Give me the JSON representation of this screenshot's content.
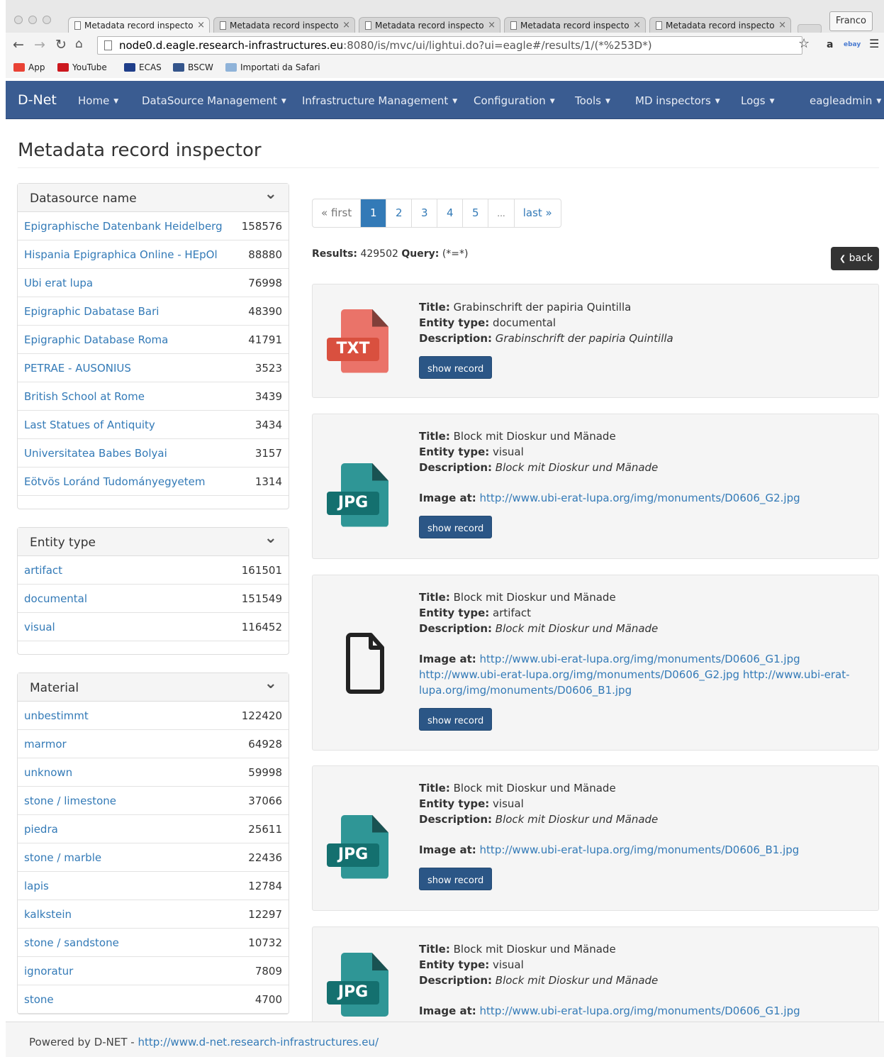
{
  "browser": {
    "tabs": [
      {
        "title": "Metadata record inspecto",
        "active": true
      },
      {
        "title": "Metadata record inspecto",
        "active": false
      },
      {
        "title": "Metadata record inspecto",
        "active": false
      },
      {
        "title": "Metadata record inspecto",
        "active": false
      },
      {
        "title": "Metadata record inspecto",
        "active": false
      }
    ],
    "profile": "Franco",
    "url_host": "node0.d.eagle.research-infrastructures.eu",
    "url_rest": ":8080/is/mvc/ui/lightui.do?ui=eagle#/results/1/(*%253D*)",
    "bookmarks": [
      {
        "label": "App",
        "icon": "apps-icon",
        "color": "#e94235"
      },
      {
        "label": "YouTube",
        "icon": "youtube-icon",
        "color": "#cc181e"
      },
      {
        "label": "ECAS",
        "icon": "ecas-icon",
        "color": "#1f3e8a"
      },
      {
        "label": "BSCW",
        "icon": "bscw-icon",
        "color": "#34558b"
      },
      {
        "label": "Importati da Safari",
        "icon": "folder-icon",
        "color": "#8fb3d9"
      }
    ]
  },
  "navbar": {
    "brand": "D-Net",
    "items": [
      "Home",
      "DataSource Management",
      "Infrastructure Management",
      "Configuration",
      "Tools",
      "MD inspectors",
      "Logs",
      "eagleadmin"
    ],
    "bg_color": "#3a5c91"
  },
  "page_title": "Metadata record inspector",
  "facets": [
    {
      "title": "Datasource name",
      "items": [
        {
          "label": "Epigraphische Datenbank Heidelberg",
          "count": "158576"
        },
        {
          "label": "Hispania Epigraphica Online - HEpOl",
          "count": "88880"
        },
        {
          "label": "Ubi erat lupa",
          "count": "76998"
        },
        {
          "label": "Epigraphic Dabatase Bari",
          "count": "48390"
        },
        {
          "label": "Epigraphic Database Roma",
          "count": "41791"
        },
        {
          "label": "PETRAE - AUSONIUS",
          "count": "3523"
        },
        {
          "label": "British School at Rome",
          "count": "3439"
        },
        {
          "label": "Last Statues of Antiquity",
          "count": "3434"
        },
        {
          "label": "Universitatea Babes Bolyai",
          "count": "3157"
        },
        {
          "label": "Eötvös Loránd Tudományegyetem",
          "count": "1314"
        }
      ]
    },
    {
      "title": "Entity type",
      "items": [
        {
          "label": "artifact",
          "count": "161501"
        },
        {
          "label": "documental",
          "count": "151549"
        },
        {
          "label": "visual",
          "count": "116452"
        }
      ]
    },
    {
      "title": "Material",
      "items": [
        {
          "label": "unbestimmt",
          "count": "122420"
        },
        {
          "label": "marmor",
          "count": "64928"
        },
        {
          "label": "unknown",
          "count": "59998"
        },
        {
          "label": "stone / limestone",
          "count": "37066"
        },
        {
          "label": "piedra",
          "count": "25611"
        },
        {
          "label": "stone / marble",
          "count": "22436"
        },
        {
          "label": "lapis",
          "count": "12784"
        },
        {
          "label": "kalkstein",
          "count": "12297"
        },
        {
          "label": "stone / sandstone",
          "count": "10732"
        },
        {
          "label": "ignoratur",
          "count": "7809"
        },
        {
          "label": "stone",
          "count": "4700"
        }
      ]
    }
  ],
  "pagination": {
    "first": "« first",
    "pages": [
      "1",
      "2",
      "3",
      "4",
      "5"
    ],
    "ellipsis": "...",
    "last": "last »",
    "active": "1"
  },
  "results_label": "Results:",
  "results_count": "429502",
  "query_label": "Query:",
  "query_value": "(*=*)",
  "back_label": "back",
  "labels": {
    "title": "Title:",
    "entity": "Entity type:",
    "description": "Description:",
    "image": "Image at:",
    "show": "show record"
  },
  "records": [
    {
      "icon": "TXT",
      "icon_color": "#e9655a",
      "title": "Grabinschrift der papiria Quintilla",
      "entity_type": "documental",
      "description": "Grabinschrift der papiria Quintilla",
      "image_links": []
    },
    {
      "icon": "JPG",
      "icon_color": "#1a8c8c",
      "title": "Block mit Dioskur und Mänade",
      "entity_type": "visual",
      "description": "Block mit Dioskur und Mänade",
      "image_links": [
        "http://www.ubi-erat-lupa.org/img/monuments/D0606_G2.jpg"
      ]
    },
    {
      "icon": "file",
      "icon_color": "#222222",
      "title": "Block mit Dioskur und Mänade",
      "entity_type": "artifact",
      "description": "Block mit Dioskur und Mänade",
      "image_links": [
        "http://www.ubi-erat-lupa.org/img/monuments/D0606_G1.jpg",
        "http://www.ubi-erat-lupa.org/img/monuments/D0606_G2.jpg",
        "http://www.ubi-erat-lupa.org/img/monuments/D0606_B1.jpg"
      ]
    },
    {
      "icon": "JPG",
      "icon_color": "#1a8c8c",
      "title": "Block mit Dioskur und Mänade",
      "entity_type": "visual",
      "description": "Block mit Dioskur und Mänade",
      "image_links": [
        "http://www.ubi-erat-lupa.org/img/monuments/D0606_B1.jpg"
      ]
    },
    {
      "icon": "JPG",
      "icon_color": "#1a8c8c",
      "title": "Block mit Dioskur und Mänade",
      "entity_type": "visual",
      "description": "Block mit Dioskur und Mänade",
      "image_links": [
        "http://www.ubi-erat-lupa.org/img/monuments/D0606_G1.jpg"
      ]
    }
  ],
  "footer": {
    "text": "Powered by D-NET - ",
    "link": "http://www.d-net.research-infrastructures.eu/"
  }
}
